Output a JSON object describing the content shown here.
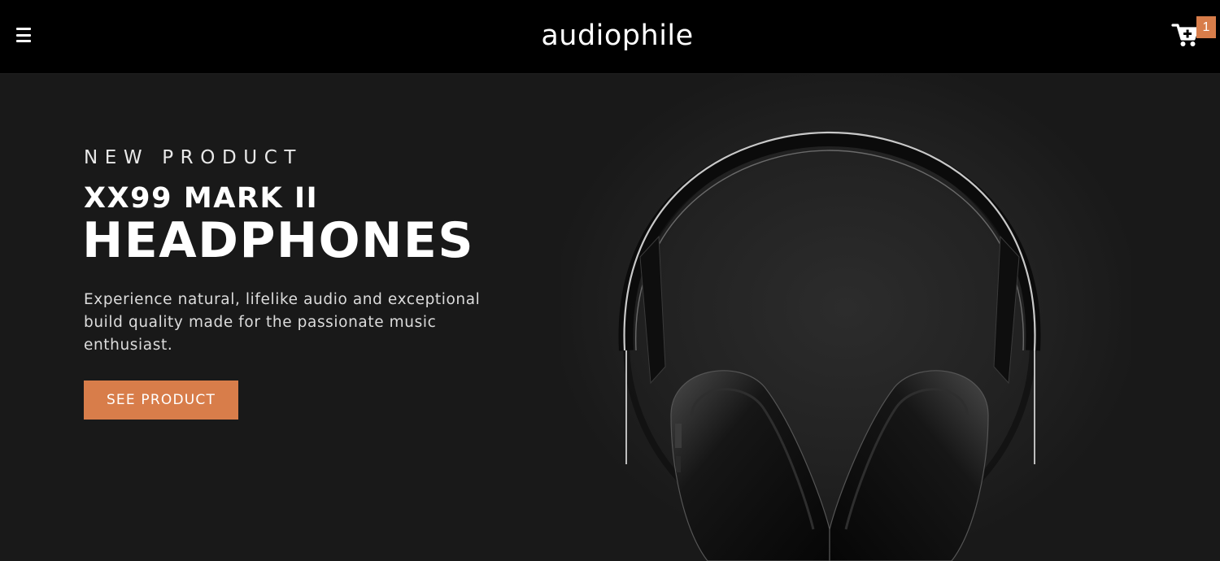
{
  "header": {
    "logo": "audiophile",
    "cart_count": "1",
    "menu_icon": "hamburger-menu-icon",
    "cart_icon": "shopping-cart-add-icon"
  },
  "hero": {
    "overline": "NEW PRODUCT",
    "title_line1": "XX99 MARK II",
    "title_line2": "HEADPHONES",
    "description": "Experience natural, lifelike audio and exceptional build quality made for the passionate music enthusiast.",
    "cta_label": "SEE PRODUCT",
    "image": "headphones-image"
  },
  "colors": {
    "accent": "#d87d4a",
    "header_bg": "#000000",
    "hero_bg": "#191919",
    "text": "#ffffff"
  }
}
